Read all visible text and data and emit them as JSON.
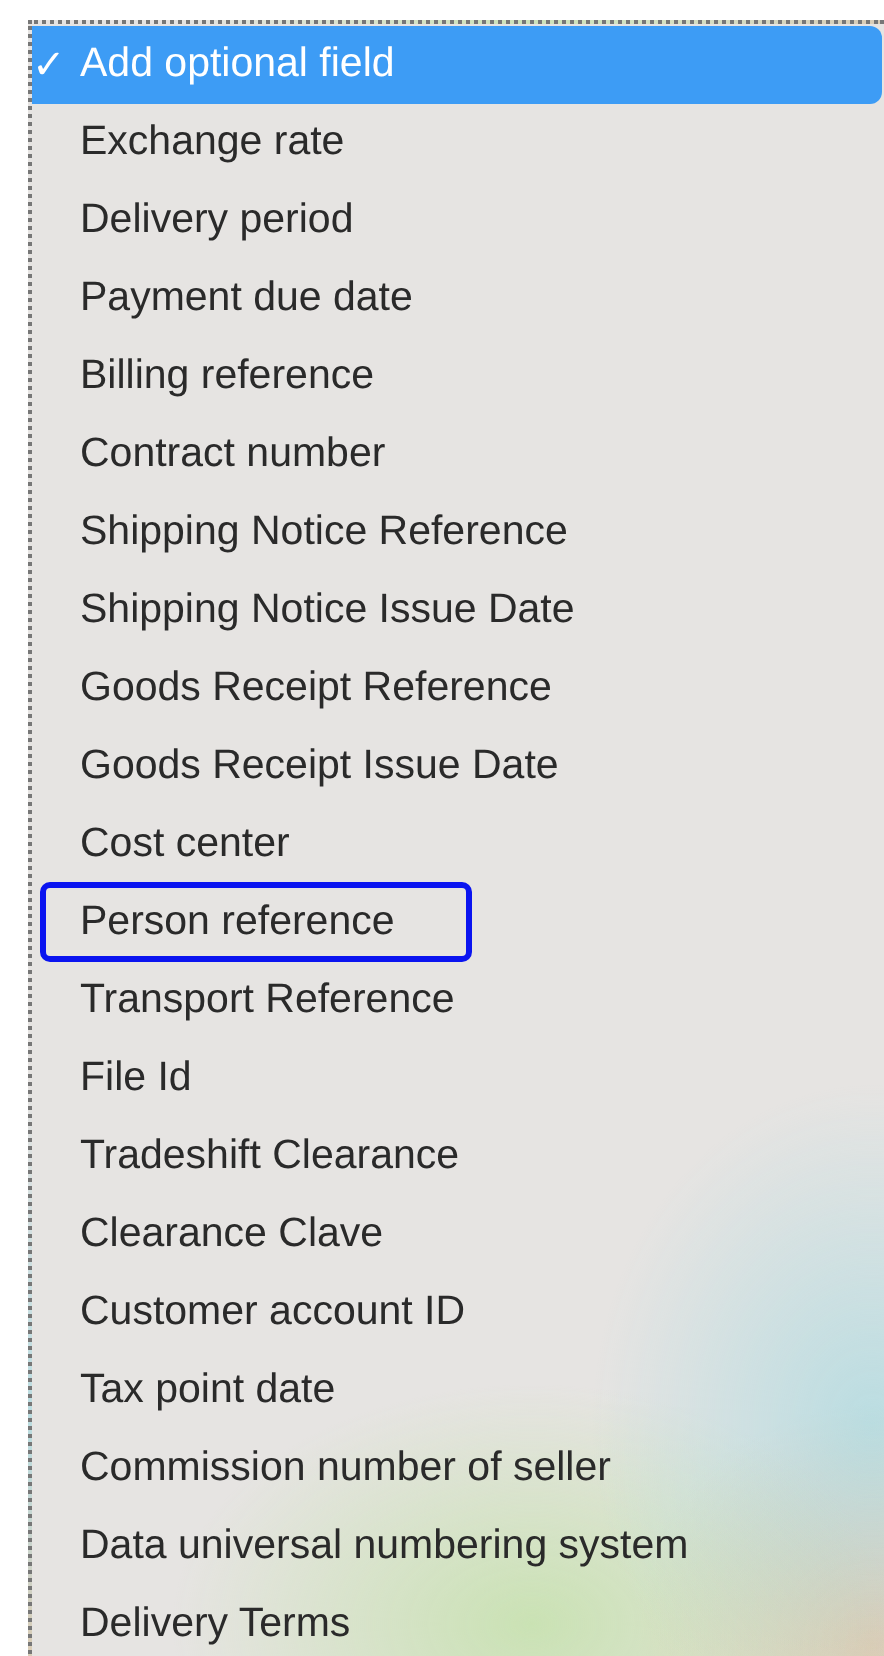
{
  "menu": {
    "check_mark": "✓",
    "items": [
      {
        "label": "Add optional field",
        "selected": true,
        "outlined": false
      },
      {
        "label": "Exchange rate",
        "selected": false,
        "outlined": false
      },
      {
        "label": "Delivery period",
        "selected": false,
        "outlined": false
      },
      {
        "label": "Payment due date",
        "selected": false,
        "outlined": false
      },
      {
        "label": "Billing reference",
        "selected": false,
        "outlined": false
      },
      {
        "label": "Contract number",
        "selected": false,
        "outlined": false
      },
      {
        "label": "Shipping Notice Reference",
        "selected": false,
        "outlined": false
      },
      {
        "label": "Shipping Notice Issue Date",
        "selected": false,
        "outlined": false
      },
      {
        "label": "Goods Receipt Reference",
        "selected": false,
        "outlined": false
      },
      {
        "label": "Goods Receipt Issue Date",
        "selected": false,
        "outlined": false
      },
      {
        "label": "Cost center",
        "selected": false,
        "outlined": false
      },
      {
        "label": "Person reference",
        "selected": false,
        "outlined": true
      },
      {
        "label": "Transport Reference",
        "selected": false,
        "outlined": false
      },
      {
        "label": "File Id",
        "selected": false,
        "outlined": false
      },
      {
        "label": "Tradeshift Clearance",
        "selected": false,
        "outlined": false
      },
      {
        "label": "Clearance Clave",
        "selected": false,
        "outlined": false
      },
      {
        "label": "Customer account ID",
        "selected": false,
        "outlined": false
      },
      {
        "label": "Tax point date",
        "selected": false,
        "outlined": false
      },
      {
        "label": "Commission number of seller",
        "selected": false,
        "outlined": false
      },
      {
        "label": "Data universal numbering system",
        "selected": false,
        "outlined": false
      },
      {
        "label": "Delivery Terms",
        "selected": false,
        "outlined": false
      }
    ]
  }
}
